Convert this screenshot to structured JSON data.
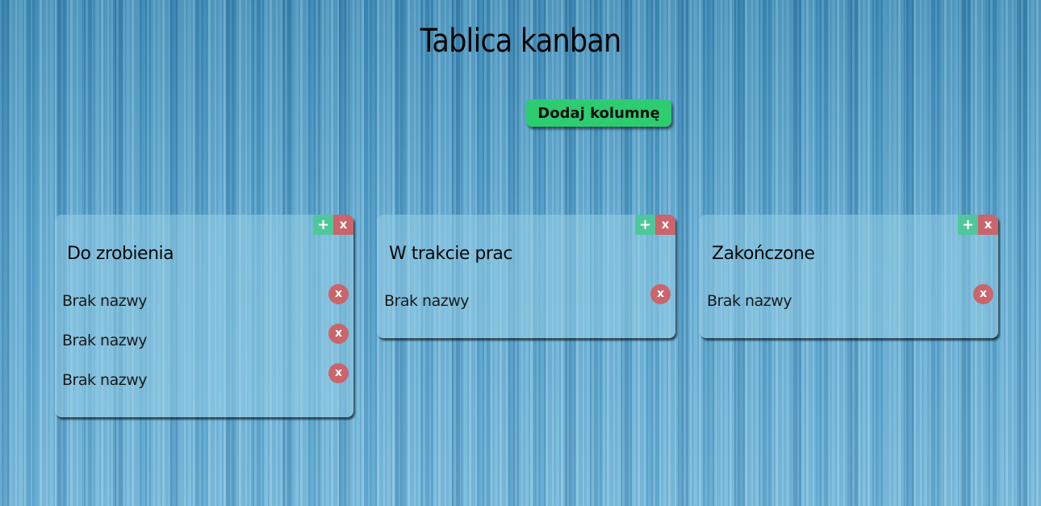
{
  "header": {
    "title": "Tablica kanban"
  },
  "toolbar": {
    "add_column_label": "Dodaj kolumnę"
  },
  "columns": [
    {
      "title": "Do zrobienia",
      "add_label": "+",
      "delete_label": "x",
      "cards": [
        {
          "name": "Brak nazwy",
          "delete_label": "x"
        },
        {
          "name": "Brak nazwy",
          "delete_label": "x"
        },
        {
          "name": "Brak nazwy",
          "delete_label": "x"
        }
      ]
    },
    {
      "title": "W trakcie prac",
      "add_label": "+",
      "delete_label": "x",
      "cards": [
        {
          "name": "Brak nazwy",
          "delete_label": "x"
        }
      ]
    },
    {
      "title": "Zakończone",
      "add_label": "+",
      "delete_label": "x",
      "cards": [
        {
          "name": "Brak nazwy",
          "delete_label": "x"
        }
      ]
    }
  ],
  "colors": {
    "add_column_button": "#2ecc71",
    "add_card_button": "#4fc79a",
    "delete_button": "#c9656b",
    "column_background": "#96cde6"
  }
}
